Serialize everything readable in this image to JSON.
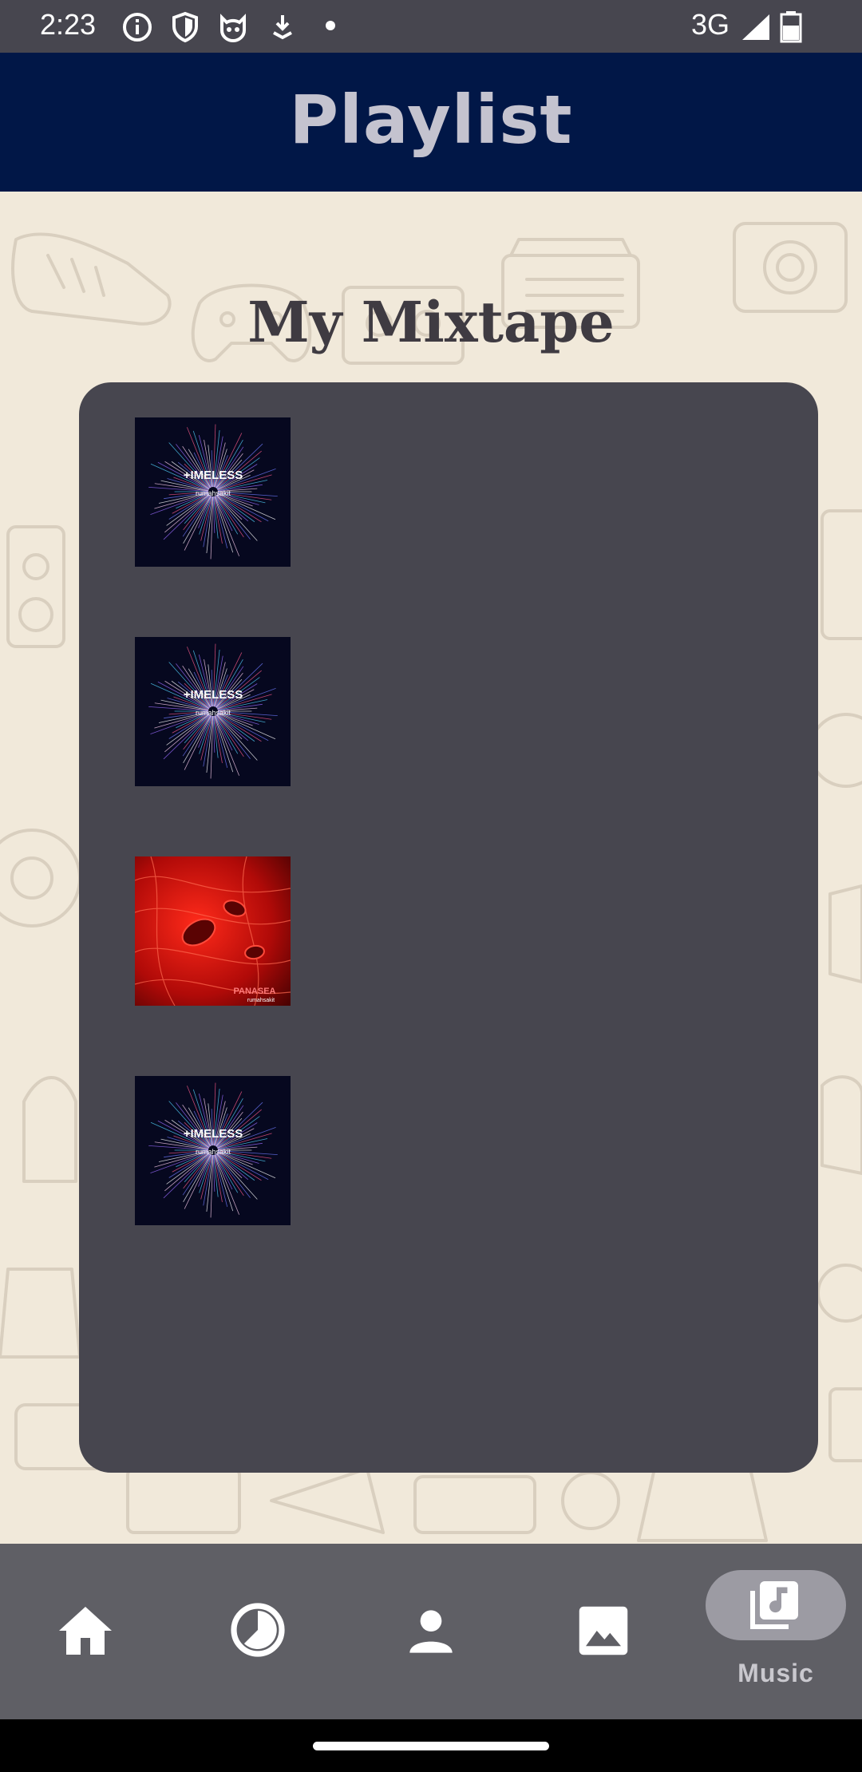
{
  "status_bar": {
    "time": "2:23",
    "network": "3G",
    "icons": [
      "info-icon",
      "shield-icon",
      "cat-face-icon",
      "download-icon",
      "dot-icon",
      "signal-icon",
      "battery-icon"
    ]
  },
  "header": {
    "title": "Playlist",
    "background_color": "#011747",
    "title_color": "#c4c3cf"
  },
  "playlist": {
    "title": "My Mixtape",
    "card_color": "#47464f",
    "tracks": [
      {
        "cover": "timeless-cover",
        "cover_title": "+IMELESS",
        "cover_artist": "rumahsakit"
      },
      {
        "cover": "timeless-cover",
        "cover_title": "+IMELESS",
        "cover_artist": "rumahsakit"
      },
      {
        "cover": "panasea-cover",
        "cover_title": "PANASEA",
        "cover_artist": "rumahsakit"
      },
      {
        "cover": "timeless-cover",
        "cover_title": "+IMELESS",
        "cover_artist": "rumahsakit"
      }
    ]
  },
  "bottom_nav": {
    "items": [
      {
        "icon": "home-icon"
      },
      {
        "icon": "history-icon"
      },
      {
        "icon": "person-icon"
      },
      {
        "icon": "image-icon"
      },
      {
        "icon": "music-library-icon",
        "label": "Music",
        "selected": true
      }
    ]
  }
}
